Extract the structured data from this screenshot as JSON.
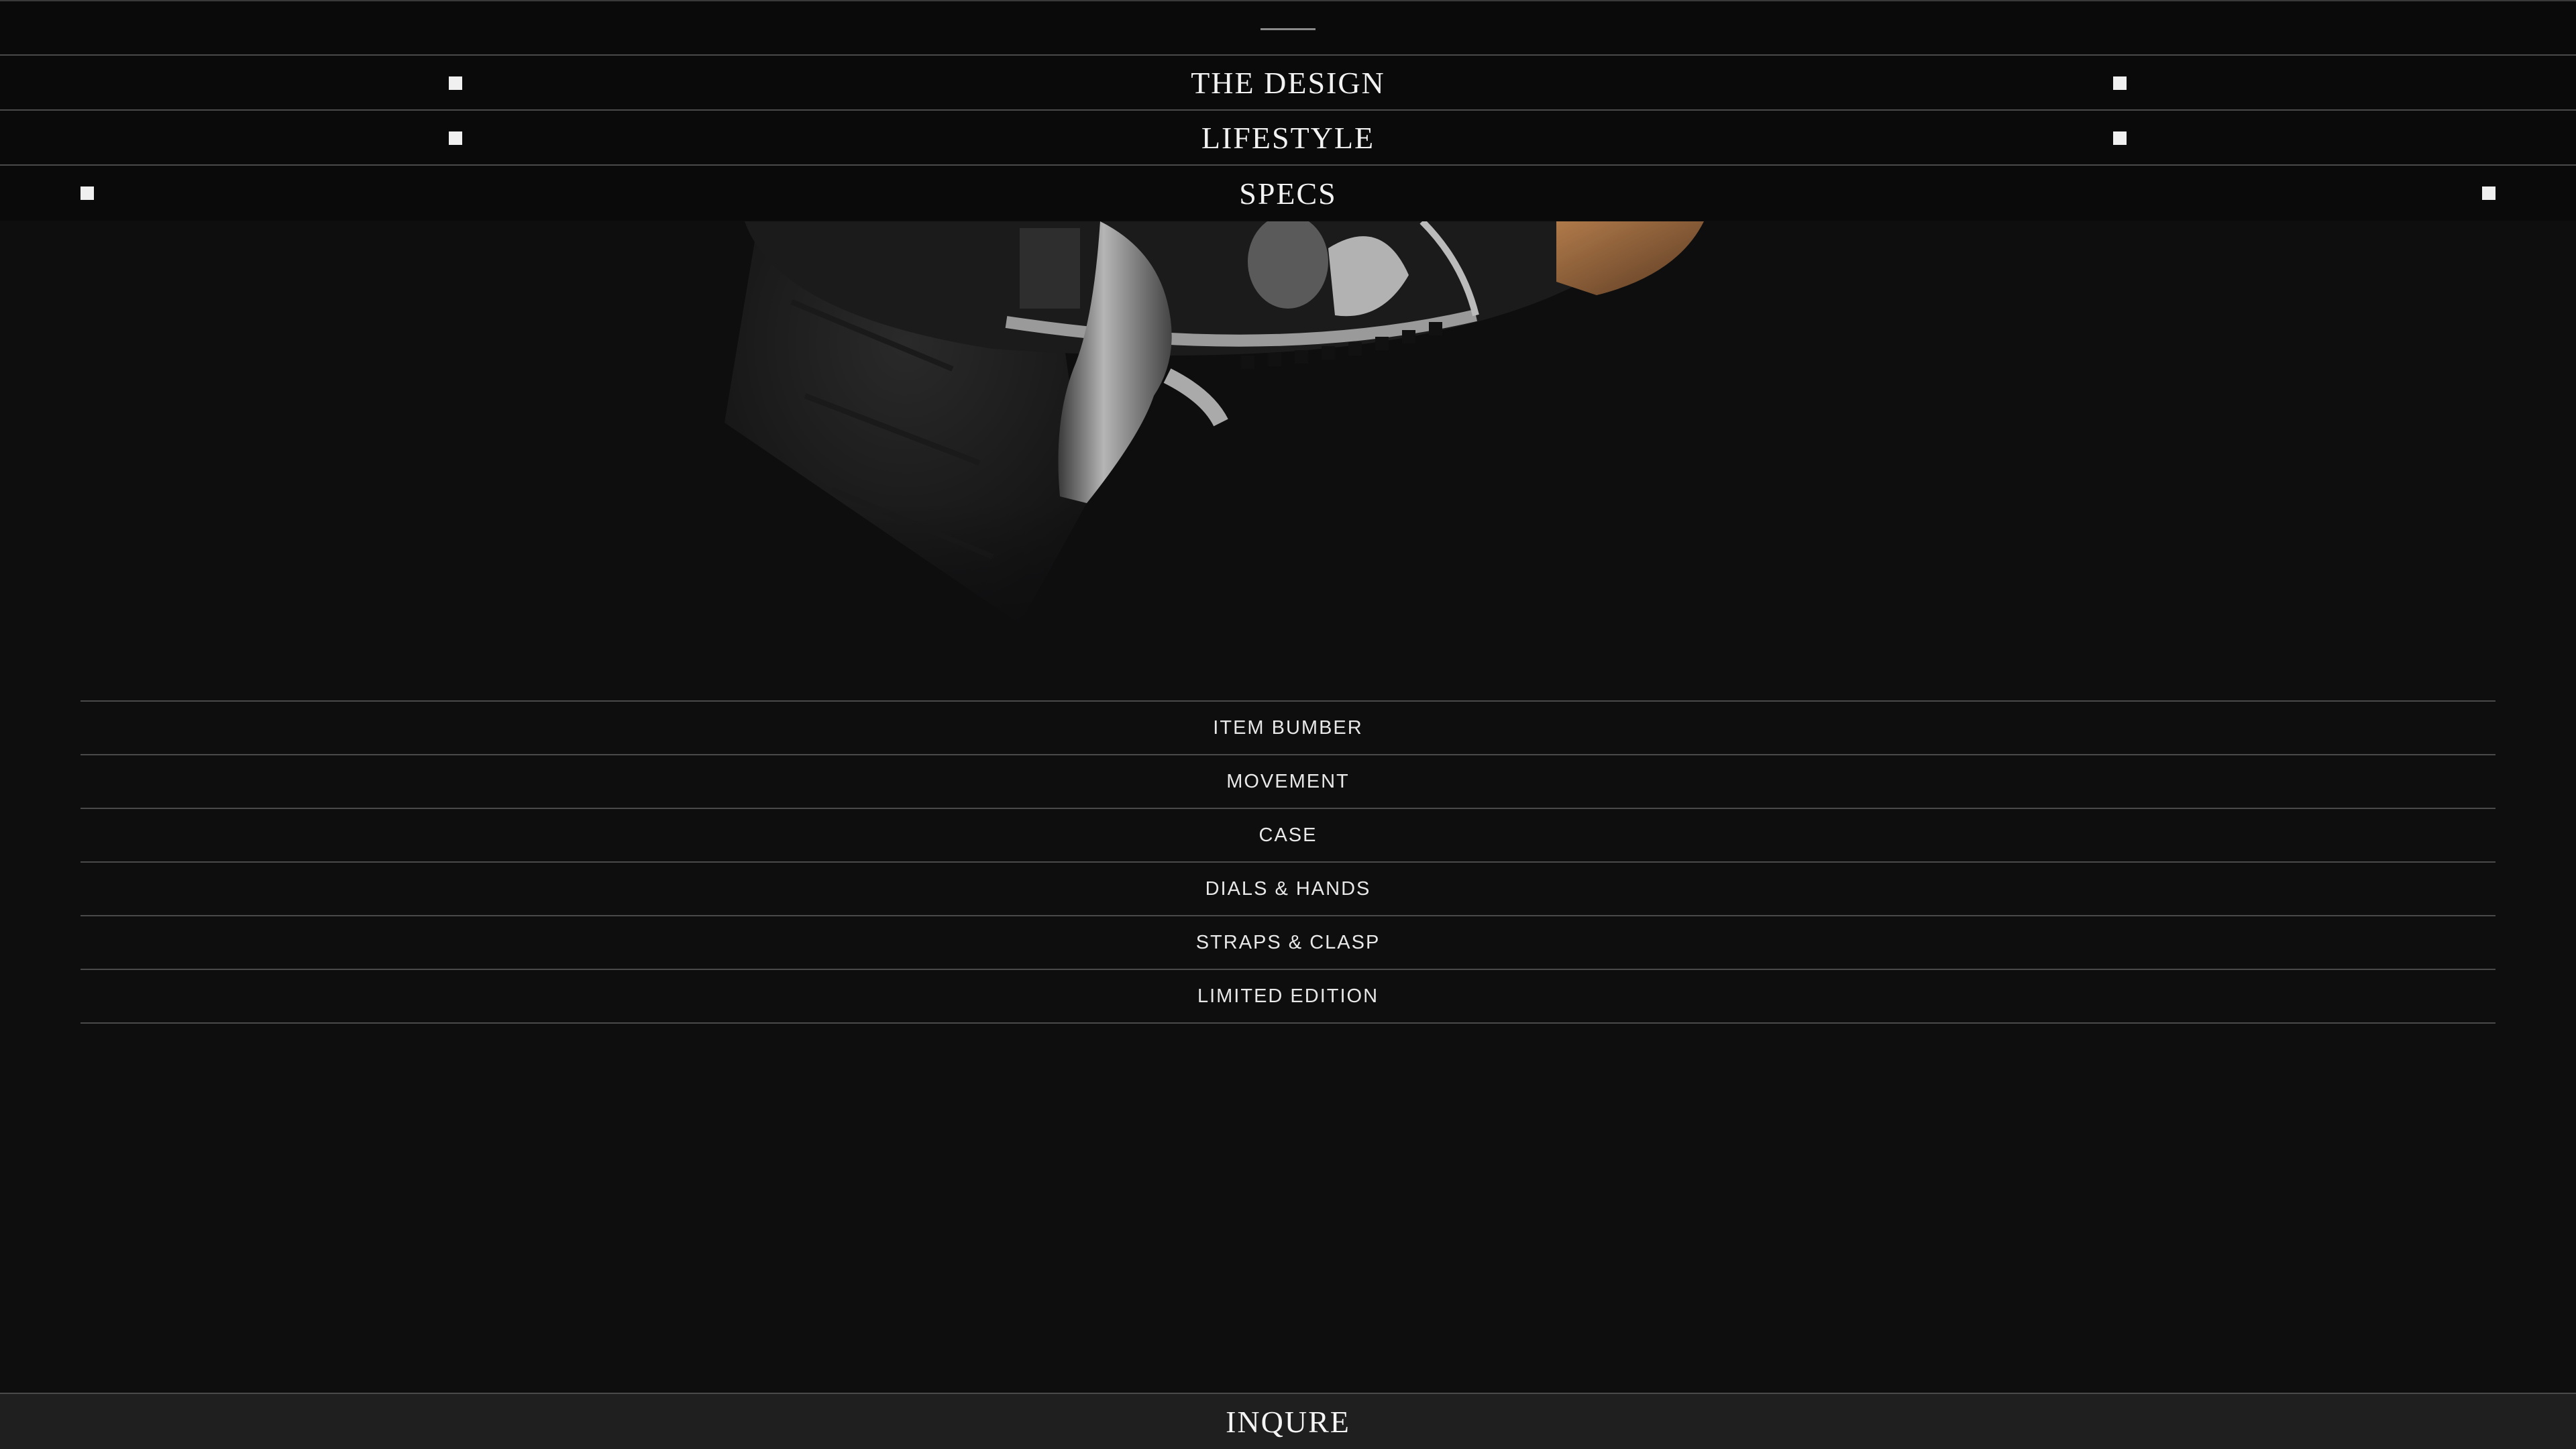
{
  "nav": {
    "items": [
      {
        "label": "THE DESIGN"
      },
      {
        "label": "LIFESTYLE"
      },
      {
        "label": "SPECS"
      }
    ]
  },
  "hero": {
    "image_icon": "watch-image"
  },
  "specs": {
    "items": [
      {
        "label": "ITEM BUMBER"
      },
      {
        "label": "MOVEMENT"
      },
      {
        "label": "CASE"
      },
      {
        "label": "DIALS & HANDS"
      },
      {
        "label": "STRAPS & CLASP"
      },
      {
        "label": "LIMITED EDITION"
      }
    ]
  },
  "cta": {
    "label": "INQURE"
  },
  "colors": {
    "background": "#0e0e0f",
    "divider": "#4a4a4a",
    "text": "#f2f2f2",
    "cta_background": "#1f1f20"
  }
}
